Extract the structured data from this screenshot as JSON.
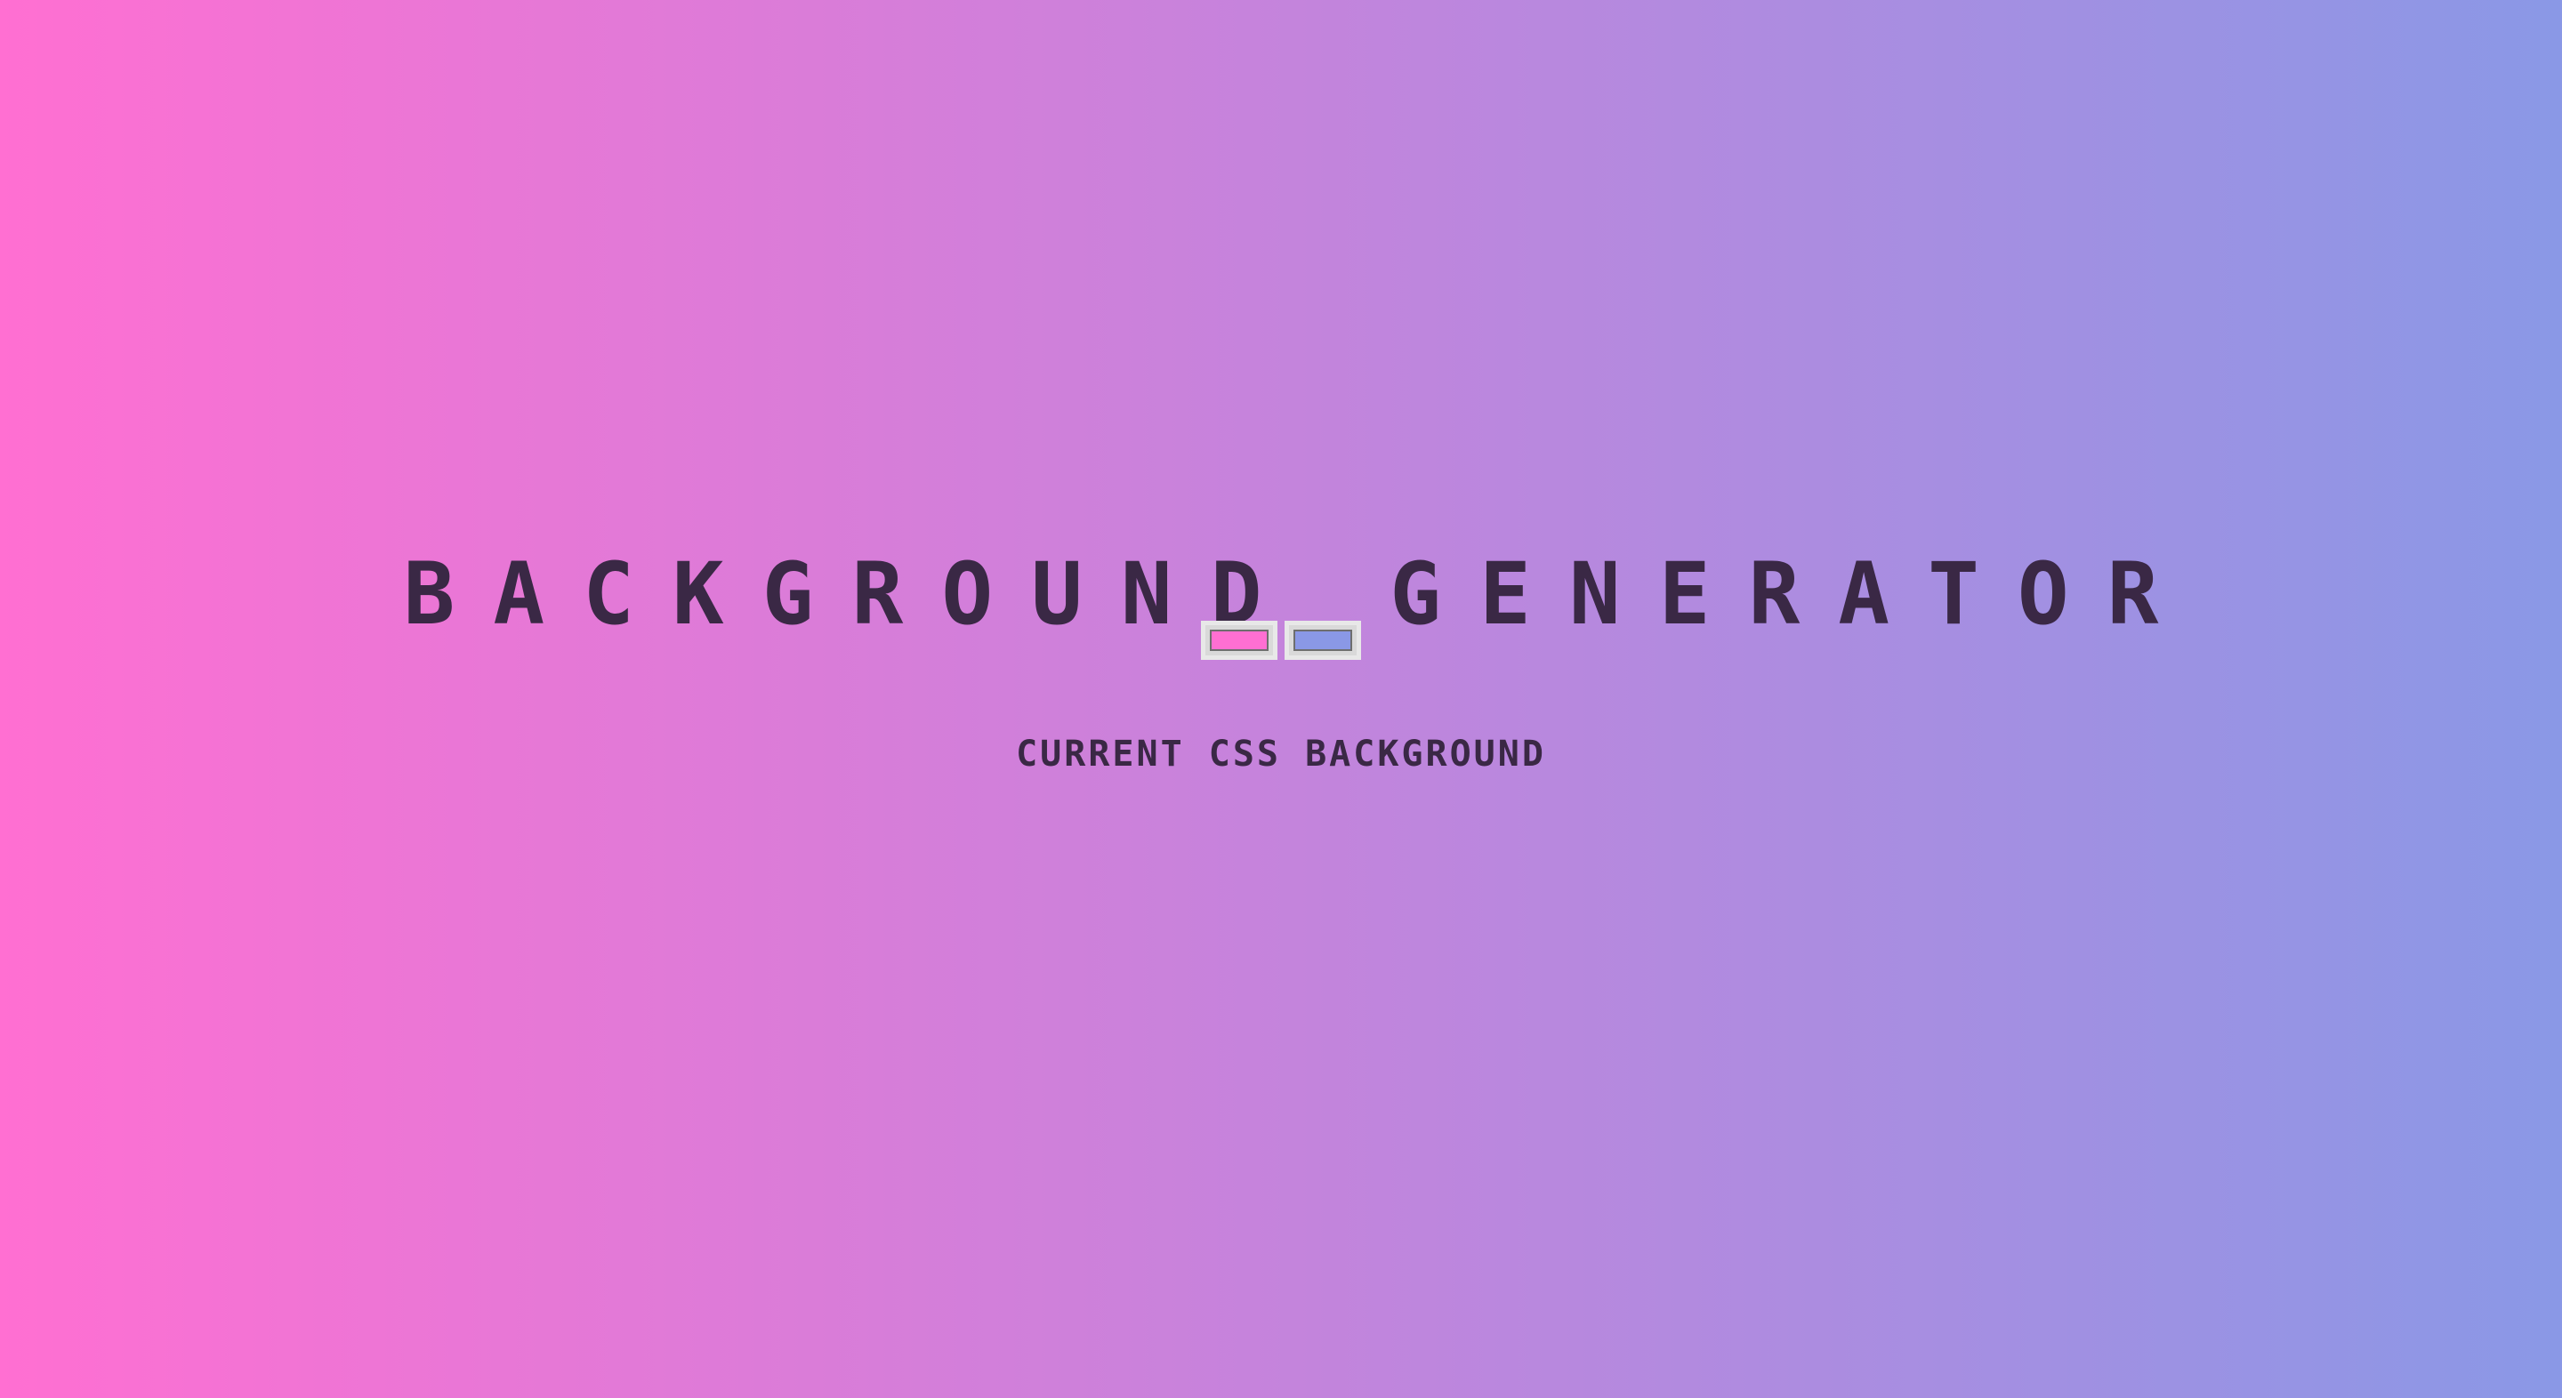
{
  "page": {
    "title": "BACKGROUND GENERATOR",
    "subtitle": "CURRENT CSS BACKGROUND"
  },
  "colors": {
    "color1": "#ff6fd2",
    "color2": "#8a98e6",
    "text": "#3a2845"
  },
  "inputs": [
    {
      "type": "color",
      "value": "#ff6fd2"
    },
    {
      "type": "color",
      "value": "#8a98e6"
    }
  ]
}
